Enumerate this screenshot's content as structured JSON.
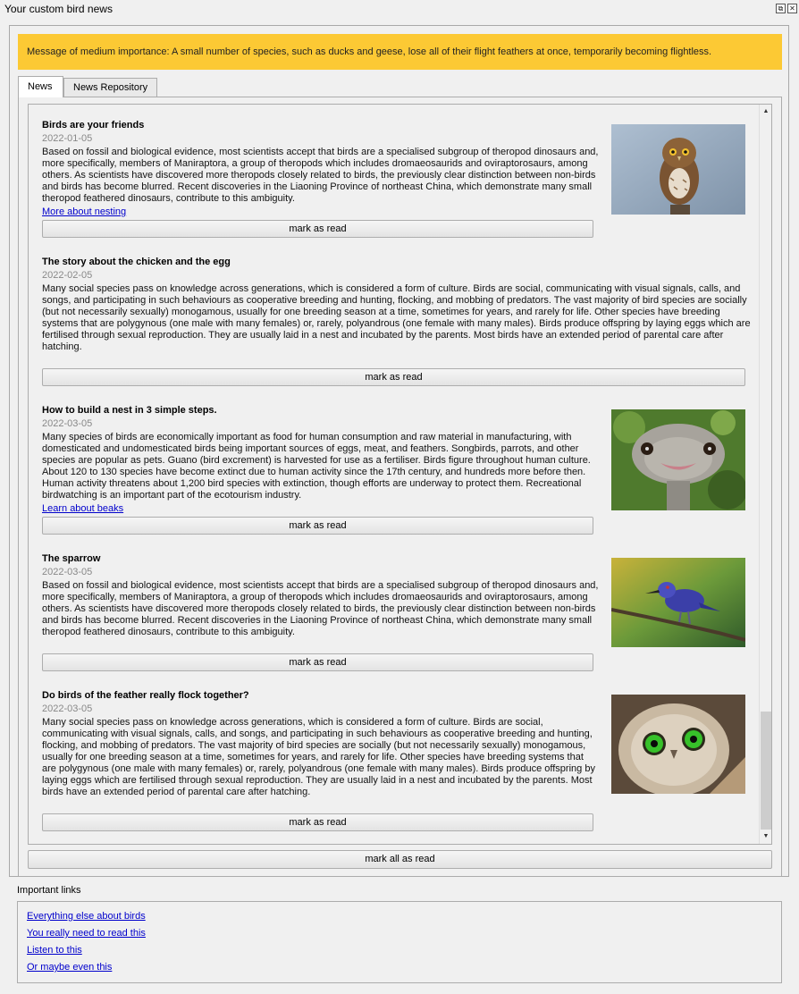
{
  "window": {
    "title": "Your custom bird news"
  },
  "banner": {
    "text": "Message of medium importance: A small number of species, such as ducks and geese, lose all of their flight feathers at once, temporarily becoming flightless."
  },
  "tabs": [
    {
      "label": "News"
    },
    {
      "label": "News Repository"
    }
  ],
  "articles": [
    {
      "title": "Birds are your friends",
      "date": "2022-01-05",
      "body": [
        "Based on fossil and biological evidence, most scientists accept that birds are a specialised subgroup of theropod dinosaurs and,",
        "more specifically, members of Maniraptora, a group of theropods which includes dromaeosaurids and oviraptorosaurs, among",
        "others. As scientists have discovered more theropods closely related to birds, the previously clear distinction between non-birds",
        "and birds has become blurred. Recent discoveries in the Liaoning Province of northeast China, which demonstrate many small",
        "theropod feathered dinosaurs, contribute to this ambiguity."
      ],
      "link": "More about nesting",
      "button": "mark as read"
    },
    {
      "title": "The story about the chicken and the egg",
      "date": "2022-02-05",
      "body": [
        "Many social species pass on knowledge across generations, which is considered a form of culture. Birds are social, communicating with visual signals, calls, and",
        "songs, and participating in such behaviours as cooperative breeding and hunting, flocking, and mobbing of predators. The vast majority of bird species are socially",
        "(but not necessarily sexually) monogamous, usually for one breeding season at a time, sometimes for years, and rarely for life. Other species have breeding",
        "systems that are polygynous (one male with many females) or, rarely, polyandrous (one female with many males). Birds produce offspring by laying eggs which are",
        "fertilised through sexual reproduction. They are usually laid in a nest and incubated by the parents. Most birds have an extended period of parental care after",
        "hatching."
      ],
      "button": "mark as read"
    },
    {
      "title": "How to build a nest in 3 simple steps.",
      "date": "2022-03-05",
      "body": [
        "Many species of birds are economically important as food for human consumption and raw material in manufacturing, with",
        "domesticated and undomesticated birds being important sources of eggs, meat, and feathers. Songbirds, parrots, and other",
        "species are popular as pets. Guano (bird excrement) is harvested for use as a fertiliser. Birds figure throughout human culture.",
        "About 120 to 130 species have become extinct due to human activity since the 17th century, and hundreds more before then.",
        "Human activity threatens about 1,200 bird species with extinction, though efforts are underway to protect them. Recreational",
        "birdwatching is an important part of the ecotourism industry."
      ],
      "link": "Learn about beaks",
      "button": "mark as read"
    },
    {
      "title": "The sparrow",
      "date": "2022-03-05",
      "body": [
        "Based on fossil and biological evidence, most scientists accept that birds are a specialised subgroup of theropod dinosaurs and,",
        "more specifically, members of Maniraptora, a group of theropods which includes dromaeosaurids and oviraptorosaurs, among",
        "others. As scientists have discovered more theropods closely related to birds, the previously clear distinction between non-birds",
        "and birds has become blurred. Recent discoveries in the Liaoning Province of northeast China, which demonstrate many small",
        "theropod feathered dinosaurs, contribute to this ambiguity."
      ],
      "button": "mark as read"
    },
    {
      "title": "Do birds of the feather really flock together?",
      "date": "2022-03-05",
      "body": [
        "Many social species pass on knowledge across generations, which is considered a form of culture. Birds are social,",
        "communicating with visual signals, calls, and songs, and participating in such behaviours as cooperative breeding and hunting,",
        "flocking, and mobbing of predators. The vast majority of bird species are socially (but not necessarily sexually) monogamous,",
        "usually for one breeding season at a time, sometimes for years, and rarely for life. Other species have breeding systems that",
        "are polygynous (one male with many females) or, rarely, polyandrous (one female with many males). Birds produce offspring by",
        "laying eggs which are fertilised through sexual reproduction. They are usually laid in a nest and incubated by the parents. Most",
        "birds have an extended period of parental care after hatching."
      ],
      "button": "mark as read"
    }
  ],
  "mark_all": "mark all as read",
  "important_links": {
    "label": "Important links",
    "links": [
      "Everything else about birds",
      "You really need to read this",
      "Listen to this",
      "Or maybe even this"
    ]
  },
  "colors": {
    "banner": "#fcc934",
    "link": "#0000cc"
  }
}
